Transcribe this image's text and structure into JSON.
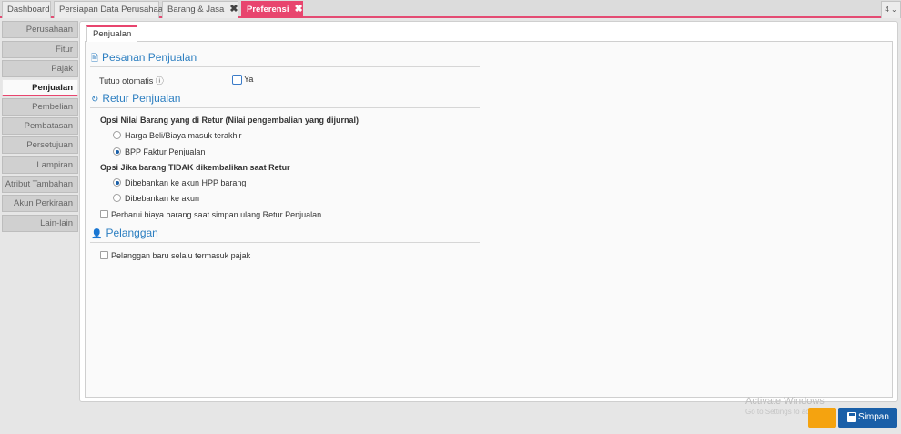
{
  "top_tabs": [
    {
      "label": "Dashboard",
      "closable": false,
      "active": false
    },
    {
      "label": "Persiapan Data Perusahaan",
      "closable": false,
      "active": false
    },
    {
      "label": "Barang & Jasa",
      "closable": true,
      "active": false
    },
    {
      "label": "Preferensi",
      "closable": true,
      "active": true
    }
  ],
  "tab_count": "4 ⌄",
  "close_glyph": "✖",
  "sidebar": {
    "items": [
      {
        "label": "Perusahaan"
      },
      {
        "label": "Fitur"
      },
      {
        "label": "Pajak"
      },
      {
        "label": "Penjualan",
        "active": true
      },
      {
        "label": "Pembelian"
      },
      {
        "label": "Pembatasan"
      },
      {
        "label": "Persetujuan"
      },
      {
        "label": "Lampiran"
      },
      {
        "label": "Atribut Tambahan"
      },
      {
        "label": "Akun Perkiraan"
      },
      {
        "label": "Lain-lain"
      }
    ]
  },
  "content_tab": "Penjualan",
  "sections": {
    "pesanan": {
      "title": "Pesanan Penjualan",
      "auto_close_label": "Tutup otomatis",
      "auto_close_option": "Ya",
      "auto_close_checked": false
    },
    "retur": {
      "title": "Retur Penjualan",
      "value_question": "Opsi Nilai Barang yang di Retur (Nilai pengembalian yang dijurnal)",
      "value_options": [
        {
          "label": "Harga Beli/Biaya masuk terakhir",
          "selected": false
        },
        {
          "label": "BPP Faktur Penjualan",
          "selected": true
        }
      ],
      "not_returned_question": "Opsi Jika barang TIDAK dikembalikan saat Retur",
      "not_returned_options": [
        {
          "label": "Dibebankan ke akun HPP barang",
          "selected": true
        },
        {
          "label": "Dibebankan ke akun",
          "selected": false
        }
      ],
      "update_cost_label": "Perbarui biaya barang saat simpan ulang Retur Penjualan",
      "update_cost_checked": false
    },
    "pelanggan": {
      "title": "Pelanggan",
      "tax_label": "Pelanggan baru selalu termasuk pajak",
      "tax_checked": false
    }
  },
  "watermark": {
    "line1": "Activate Windows",
    "line2": "Go to Settings to ac"
  },
  "buttons": {
    "save": "Simpan"
  },
  "colors": {
    "accent_pink": "#e8456e",
    "link_blue": "#2d7fc1",
    "save_blue": "#1a5fa8",
    "orange": "#f5a30f"
  }
}
